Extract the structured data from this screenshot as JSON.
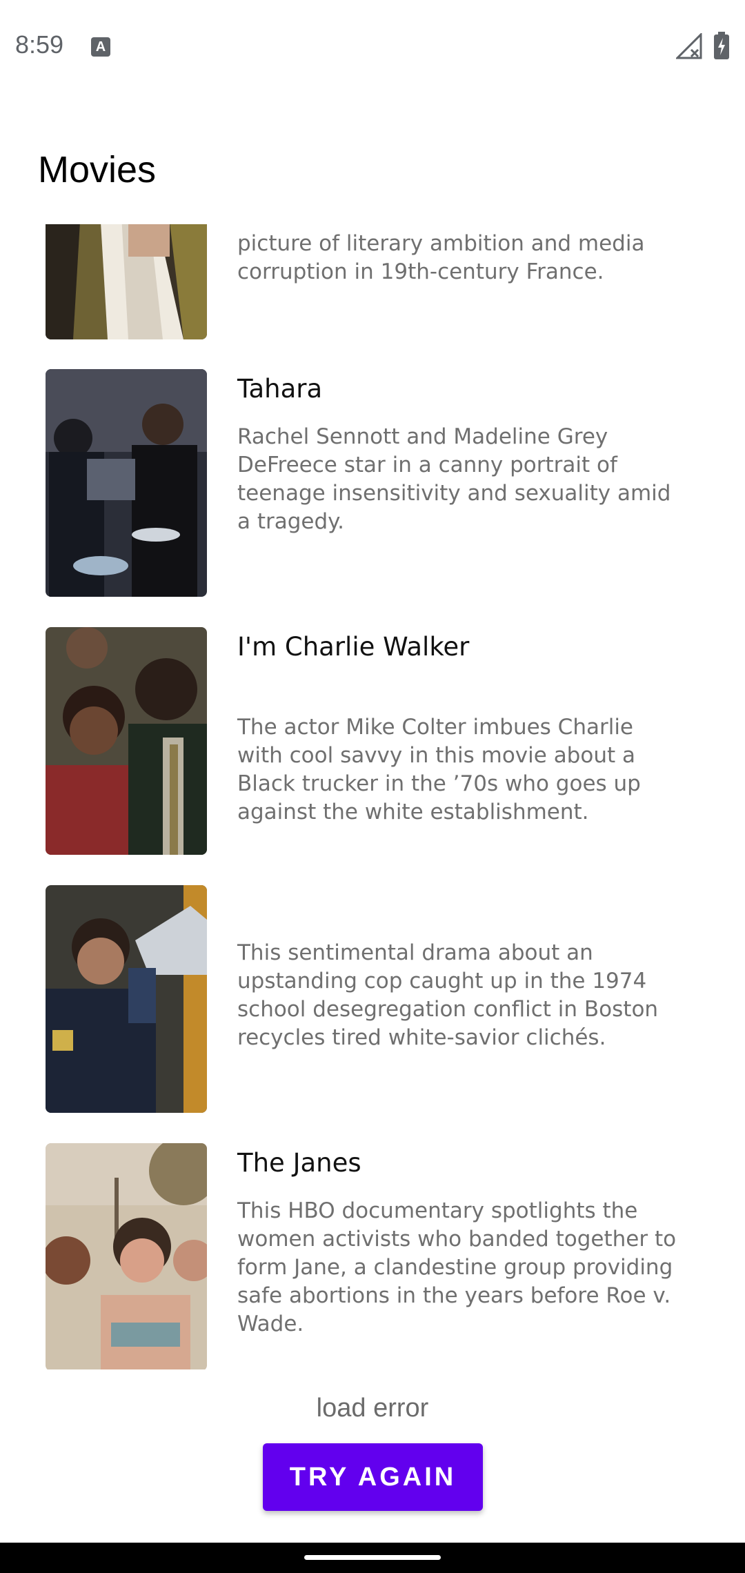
{
  "status_bar": {
    "time": "8:59",
    "notification_icon": "text-a-icon",
    "signal_icon": "no-signal-icon",
    "battery_icon": "battery-charging-icon"
  },
  "header": {
    "title": "Movies"
  },
  "movies": [
    {
      "title": "",
      "description": "picture of literary ambition and media corruption in 19th-century France.",
      "image": "lost-illusions-still"
    },
    {
      "title": "Tahara",
      "description": "Rachel Sennott and Madeline Grey DeFreece star in a canny portrait of teenage insensitivity and sexuality amid a tragedy.",
      "image": "tahara-still"
    },
    {
      "title": "I'm Charlie Walker",
      "description": "The actor Mike Colter imbues Charlie with cool savvy in this movie about a Black trucker in the ’70s who goes up against the white establishment.",
      "image": "charlie-walker-still"
    },
    {
      "title": "",
      "description": "This sentimental drama about an upstanding cop caught up in the 1974 school desegregation conflict in Boston recycles tired white-savior clichés.",
      "image": "cop-megaphone-still"
    },
    {
      "title": "The Janes",
      "description": "This HBO documentary spotlights the women activists who banded together to form Jane, a clandestine group providing safe abortions in the years before Roe v. Wade.",
      "image": "the-janes-still"
    }
  ],
  "error": {
    "message": "load error",
    "retry_label": "TRY AGAIN"
  },
  "colors": {
    "accent": "#6200ee",
    "title_text": "#111111",
    "body_text": "#6f6f6f"
  }
}
